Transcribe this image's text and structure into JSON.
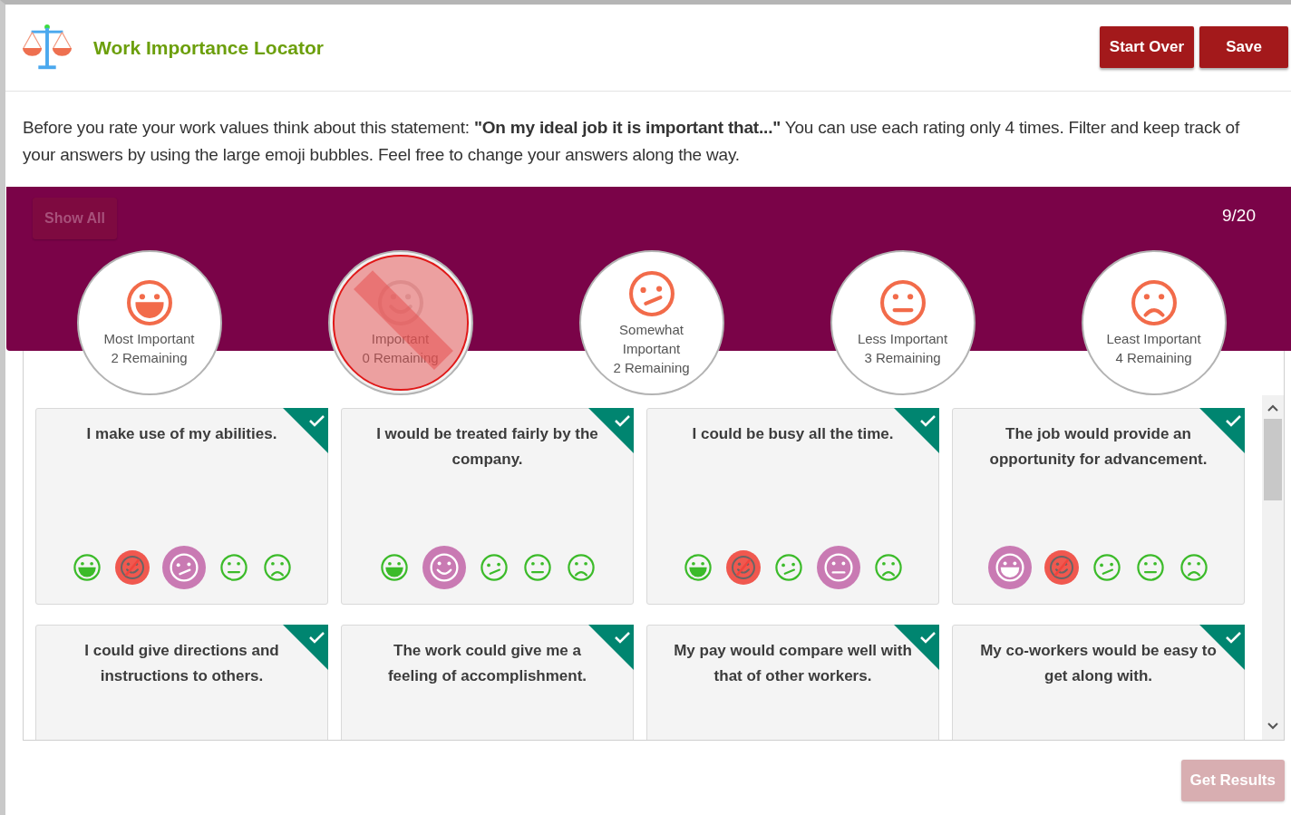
{
  "header": {
    "title": "Work Importance Locator",
    "buttons": [
      {
        "label": "Start Over"
      },
      {
        "label": "Save"
      }
    ]
  },
  "instructions": "Before you rate your work values think about this statement: **\"On my ideal job it is important that...\"** You can use each rating only 4 times. Filter and keep track of your answers by using the large emoji bubbles. Feel free to change your answers along the way.",
  "filter_bar": {
    "show_all": {
      "label": "Show All",
      "disabled": true
    },
    "progress": "9/20"
  },
  "categories": [
    {
      "kind": "grin",
      "label": "Most Important",
      "remaining": "2 Remaining",
      "disabled": false
    },
    {
      "kind": "smile",
      "label": "Important",
      "remaining": "0 Remaining",
      "disabled": true
    },
    {
      "kind": "smirk",
      "label": "Somewhat Important",
      "remaining": "2 Remaining",
      "disabled": false
    },
    {
      "kind": "neutral",
      "label": "Less Important",
      "remaining": "3 Remaining",
      "disabled": false
    },
    {
      "kind": "frown",
      "label": "Least Important",
      "remaining": "4 Remaining",
      "disabled": false
    }
  ],
  "cards": [
    {
      "statement": "I make use of my abilities.",
      "completed": true,
      "ratings": [
        {
          "kind": "grin",
          "selected": false,
          "disabled": false
        },
        {
          "kind": "smile",
          "selected": false,
          "disabled": true
        },
        {
          "kind": "smirk",
          "selected": true,
          "disabled": false
        },
        {
          "kind": "neutral",
          "selected": false,
          "disabled": false
        },
        {
          "kind": "frown",
          "selected": false,
          "disabled": false
        }
      ]
    },
    {
      "statement": "I would be treated fairly by the company.",
      "completed": true,
      "ratings": [
        {
          "kind": "grin",
          "selected": false,
          "disabled": false
        },
        {
          "kind": "smile",
          "selected": true,
          "disabled": false
        },
        {
          "kind": "smirk",
          "selected": false,
          "disabled": false
        },
        {
          "kind": "neutral",
          "selected": false,
          "disabled": false
        },
        {
          "kind": "frown",
          "selected": false,
          "disabled": false
        }
      ]
    },
    {
      "statement": "I could be busy all the time.",
      "completed": true,
      "ratings": [
        {
          "kind": "grin",
          "selected": false,
          "disabled": false
        },
        {
          "kind": "smile",
          "selected": false,
          "disabled": true
        },
        {
          "kind": "smirk",
          "selected": false,
          "disabled": false
        },
        {
          "kind": "neutral",
          "selected": true,
          "disabled": false
        },
        {
          "kind": "frown",
          "selected": false,
          "disabled": false
        }
      ]
    },
    {
      "statement": "The job would provide an opportunity for advancement.",
      "completed": true,
      "ratings": [
        {
          "kind": "grin",
          "selected": true,
          "disabled": false
        },
        {
          "kind": "smile",
          "selected": false,
          "disabled": true
        },
        {
          "kind": "smirk",
          "selected": false,
          "disabled": false
        },
        {
          "kind": "neutral",
          "selected": false,
          "disabled": false
        },
        {
          "kind": "frown",
          "selected": false,
          "disabled": false
        }
      ]
    },
    {
      "statement": "I could give directions and instructions to others.",
      "completed": true
    },
    {
      "statement": "The work could give me a feeling of accomplishment.",
      "completed": true
    },
    {
      "statement": "My pay would compare well with that of other workers.",
      "completed": true
    },
    {
      "statement": "My co-workers would be easy to get along with.",
      "completed": true
    }
  ],
  "get_results": {
    "label": "Get Results",
    "disabled": true
  }
}
